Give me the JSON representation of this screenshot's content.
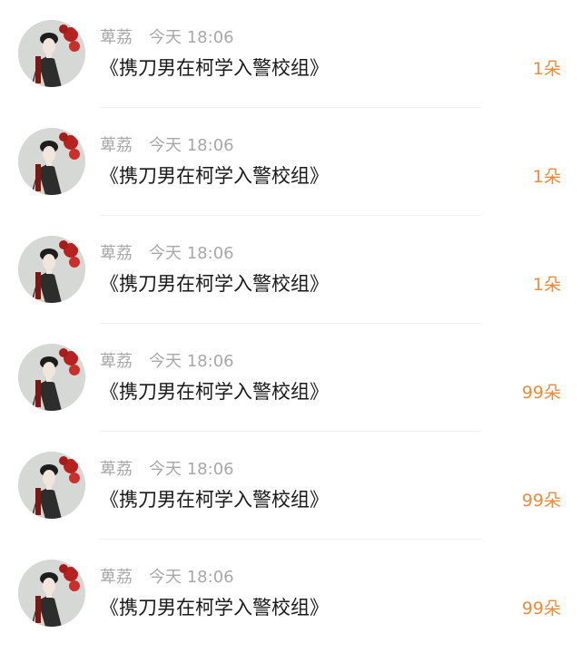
{
  "colors": {
    "meta_text": "#a8a8a8",
    "title_text": "#1a1a1a",
    "amount_text": "#ef8a38",
    "divider": "#efefef",
    "background": "#ffffff"
  },
  "gifts": [
    {
      "avatar": "user-avatar-icon",
      "username": "萆荔",
      "time": "今天 18:06",
      "title": "《携刀男在柯学入警校组》",
      "amount": "1朵"
    },
    {
      "avatar": "user-avatar-icon",
      "username": "萆荔",
      "time": "今天 18:06",
      "title": "《携刀男在柯学入警校组》",
      "amount": "1朵"
    },
    {
      "avatar": "user-avatar-icon",
      "username": "萆荔",
      "time": "今天 18:06",
      "title": "《携刀男在柯学入警校组》",
      "amount": "1朵"
    },
    {
      "avatar": "user-avatar-icon",
      "username": "萆荔",
      "time": "今天 18:06",
      "title": "《携刀男在柯学入警校组》",
      "amount": "99朵"
    },
    {
      "avatar": "user-avatar-icon",
      "username": "萆荔",
      "time": "今天 18:06",
      "title": "《携刀男在柯学入警校组》",
      "amount": "99朵"
    },
    {
      "avatar": "user-avatar-icon",
      "username": "萆荔",
      "time": "今天 18:06",
      "title": "《携刀男在柯学入警校组》",
      "amount": "99朵"
    }
  ]
}
